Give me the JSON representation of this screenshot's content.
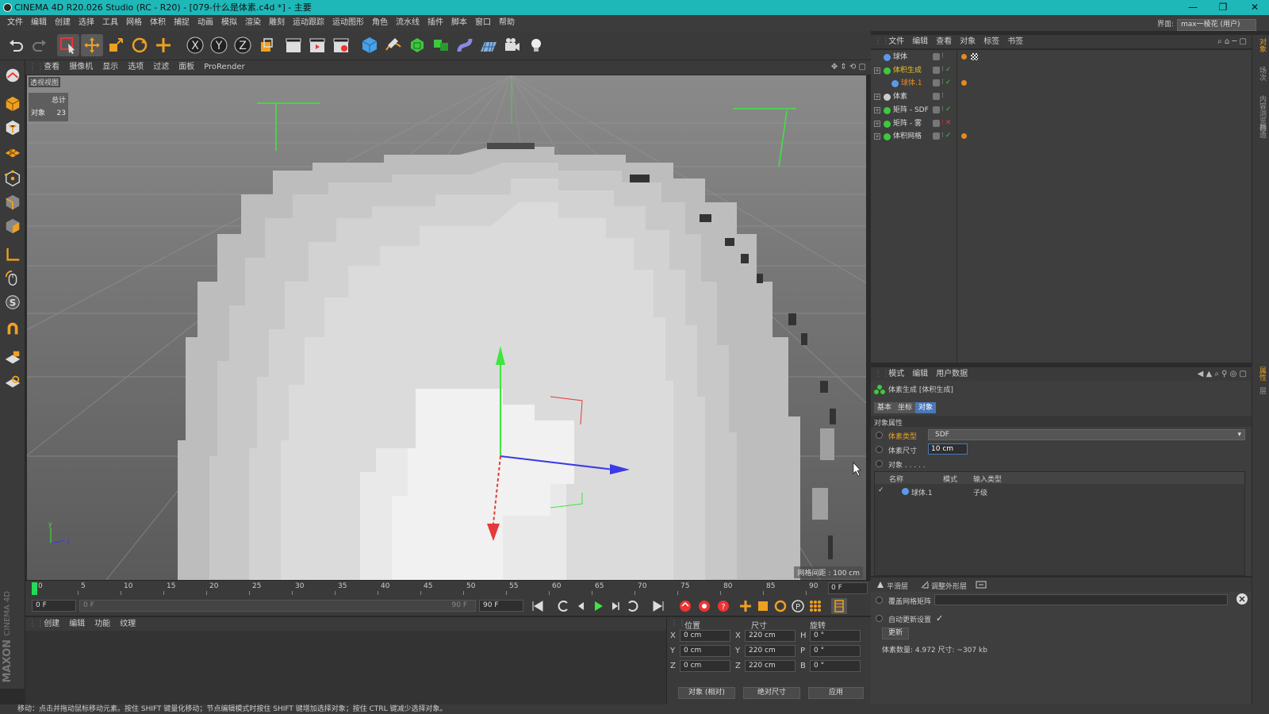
{
  "window": {
    "title": "CINEMA 4D R20.026 Studio (RC - R20) - [079-什么是体素.c4d *] - 主要",
    "minimize": "—",
    "maximize": "❐",
    "close": "✕"
  },
  "menubar": {
    "items": [
      "文件",
      "编辑",
      "创建",
      "选择",
      "工具",
      "网格",
      "体积",
      "捕捉",
      "动画",
      "模拟",
      "渲染",
      "雕刻",
      "运动跟踪",
      "运动图形",
      "角色",
      "流水线",
      "插件",
      "脚本",
      "窗口",
      "帮助"
    ],
    "interface_label": "界面:",
    "interface_value": "max一棱花 (用户)"
  },
  "viewport": {
    "menu": [
      "查看",
      "摄像机",
      "显示",
      "选项",
      "过滤",
      "面板",
      "ProRender"
    ],
    "view_label": "透视视图",
    "hud_total_label": "总计",
    "hud_objects_label": "对象",
    "hud_objects_value": "23",
    "grid_spacing": "网格间距 : 100 cm",
    "background": "#6a6a6a"
  },
  "timeline": {
    "ticks": [
      "0",
      "5",
      "10",
      "15",
      "20",
      "25",
      "30",
      "35",
      "40",
      "45",
      "50",
      "55",
      "60",
      "65",
      "70",
      "75",
      "80",
      "85",
      "90"
    ],
    "current_frame_field": "0 F",
    "start_field": "0 F",
    "range_start": "0 F",
    "range_end": "90 F",
    "end_field": "90 F"
  },
  "material_manager": {
    "menu": [
      "创建",
      "编辑",
      "功能",
      "纹理"
    ]
  },
  "coordinates": {
    "position_header": "位置",
    "size_header": "尺寸",
    "rotation_header": "旋转",
    "rows": [
      {
        "axis": "X",
        "pos": "0 cm",
        "size_axis": "X",
        "size": "220 cm",
        "rot_axis": "H",
        "rot": "0 °"
      },
      {
        "axis": "Y",
        "pos": "0 cm",
        "size_axis": "Y",
        "size": "220 cm",
        "rot_axis": "P",
        "rot": "0 °"
      },
      {
        "axis": "Z",
        "pos": "0 cm",
        "size_axis": "Z",
        "size": "220 cm",
        "rot_axis": "B",
        "rot": "0 °"
      }
    ],
    "mode_dropdown": "对象 (相对)",
    "size_dropdown": "绝对尺寸",
    "apply_button": "应用"
  },
  "statusbar": {
    "text": "移动：点击并拖动鼠标移动元素。按住 SHIFT 键量化移动；节点编辑模式时按住 SHIFT 键增加选择对象；按住 CTRL 键减少选择对象。"
  },
  "object_manager": {
    "menu": [
      "文件",
      "编辑",
      "查看",
      "对象",
      "标签",
      "书签"
    ],
    "objects": [
      {
        "name": "球体",
        "indent": 0,
        "color": "#d8d8d8"
      },
      {
        "name": "体积生成",
        "indent": 0,
        "color": "#e8c020"
      },
      {
        "name": "球体.1",
        "indent": 1,
        "color": "#e88a20"
      },
      {
        "name": "体素",
        "indent": 0,
        "color": "#d8d8d8"
      },
      {
        "name": "矩阵 - SDF",
        "indent": 0,
        "color": "#d8d8d8"
      },
      {
        "name": "矩阵 - 雾",
        "indent": 0,
        "color": "#d8d8d8"
      },
      {
        "name": "体积网格",
        "indent": 0,
        "color": "#d8d8d8"
      }
    ]
  },
  "attribute_manager": {
    "menu": [
      "模式",
      "编辑",
      "用户数据"
    ],
    "object_title": "体素生成 [体积生成]",
    "tabs": [
      "基本",
      "坐标",
      "对象"
    ],
    "active_tab": "对象",
    "section_title": "对象属性",
    "voxel_type_label": "体素类型",
    "voxel_type_value": "SDF",
    "voxel_size_label": "体素尺寸",
    "voxel_size_value": "10 cm",
    "objects_label": "对象 . . . . .",
    "table_headers": [
      "名称",
      "模式",
      "输入类型"
    ],
    "table_rows": [
      {
        "name": "球体.1",
        "type": "子级"
      }
    ]
  },
  "layer_panel": {
    "buttons": [
      "平滑层",
      "调整外形层"
    ],
    "option_label": "覆盖网格矩阵",
    "auto_update_label": "自动更新设置",
    "update_button": "更新",
    "info": "体素数量: 4.972  尺寸: ~307 kb"
  },
  "right_strip": {
    "tabs": [
      "对象",
      "场次",
      "内容浏览器",
      "构造"
    ],
    "tabs2": [
      "属性",
      "层"
    ]
  },
  "brand": {
    "maxon_label": "MAXON",
    "cinema_label": "CINEMA 4D"
  }
}
